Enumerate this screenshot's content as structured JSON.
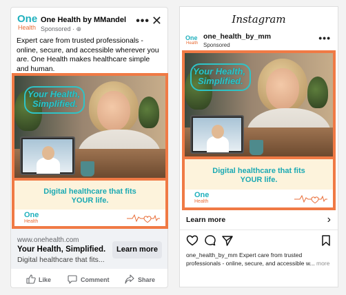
{
  "facebook": {
    "page_name": "One Health by MMandel",
    "sponsored": "Sponsored · ⊕",
    "more_icon": "more-dots-icon",
    "close_icon": "close-icon",
    "logo_one": "One",
    "logo_health": "Health",
    "primary_text": "Expert care from trusted professionals - online, secure, and accessible wherever you are. One Health makes healthcare simple and human.",
    "creative": {
      "headline_line1": "Your Health,",
      "headline_line2": "Simplified.",
      "tagline_line1": "Digital healthcare that fits",
      "tagline_line2": "YOUR life.",
      "logo_one": "One",
      "logo_health": "Health"
    },
    "link": {
      "domain": "www.onehealth.com",
      "title": "Your Health, Simplified.",
      "description": "Digital healthcare that fits...",
      "cta": "Learn more"
    },
    "actions": {
      "like": "Like",
      "comment": "Comment",
      "share": "Share"
    }
  },
  "instagram": {
    "wordmark": "Instagram",
    "username": "one_health_by_mm",
    "sponsored": "Sponsored",
    "avatar_one": "One",
    "avatar_health": "Health",
    "creative": {
      "headline_line1": "Your Health,",
      "headline_line2": "Simplified.",
      "tagline_line1": "Digital healthcare that fits",
      "tagline_line2": "YOUR life.",
      "logo_one": "One",
      "logo_health": "Health"
    },
    "cta": "Learn more",
    "caption_user": "one_health_by_mm",
    "caption_text": " Expert care from trusted professionals - online, secure, and accessible w...",
    "caption_more": " more"
  },
  "colors": {
    "brand_teal": "#1fb0bd",
    "brand_orange": "#f07a45",
    "panel_cream": "#fdf3dc",
    "fb_link_bg": "#f0f2f5",
    "fb_button_bg": "#e4e6eb"
  }
}
